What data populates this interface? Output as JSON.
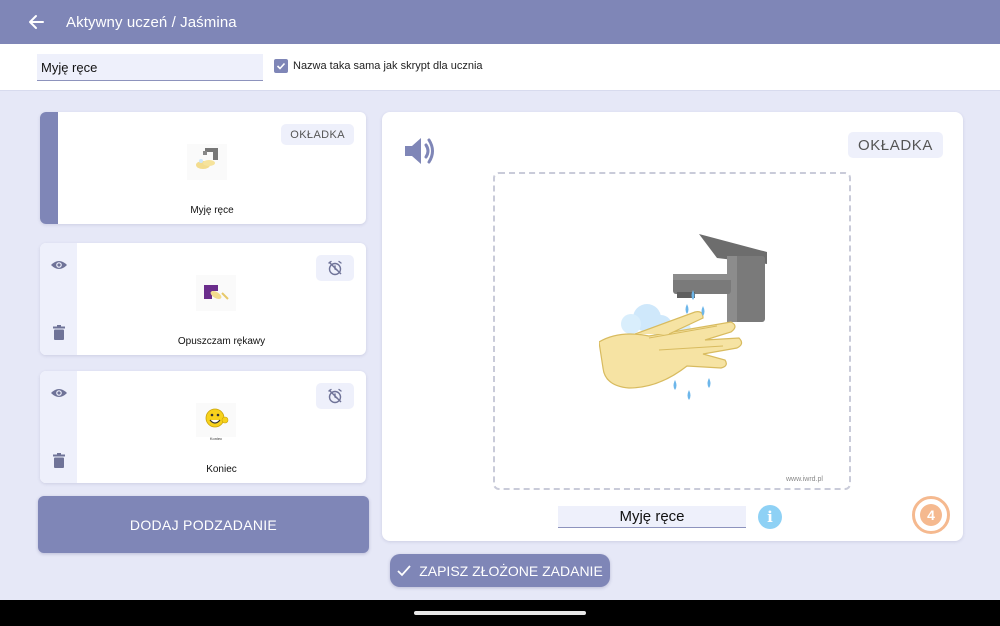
{
  "header": {
    "title": "Aktywny uczeń / Jaśmina",
    "back_icon": "arrow-left-icon"
  },
  "task": {
    "name_value": "Myję ręce",
    "same_name_checked": true,
    "same_name_label": "Nazwa taka sama jak skrypt dla ucznia"
  },
  "subtasks": [
    {
      "label": "Myję ręce",
      "badge": "OKŁADKA",
      "icon": "washing-hands-thumbnail"
    },
    {
      "label": "Opuszczam rękawy",
      "icon": "sleeves-thumbnail",
      "visibility_icon": "eye-icon",
      "delete_icon": "trash-icon",
      "alarm_icon": "alarm-off-icon"
    },
    {
      "label": "Koniec",
      "icon": "smiley-thumbnail",
      "visibility_icon": "eye-icon",
      "delete_icon": "trash-icon",
      "alarm_icon": "alarm-off-icon"
    }
  ],
  "add_subtask_label": "DODAJ PODZADANIE",
  "preview": {
    "badge": "OKŁADKA",
    "caption": "Myję ręce",
    "watermark": "www.iwrd.pl",
    "step_number": "4",
    "speaker_icon": "speaker-icon",
    "info_icon": "info-icon",
    "smiley_caption": "Koniec"
  },
  "save_label": "ZAPISZ ZŁOŻONE ZADANIE",
  "colors": {
    "primary": "#7f86b7",
    "background": "#e6e8f7",
    "accent_orange": "#f5b98f",
    "info_blue": "#8ed1f5"
  }
}
